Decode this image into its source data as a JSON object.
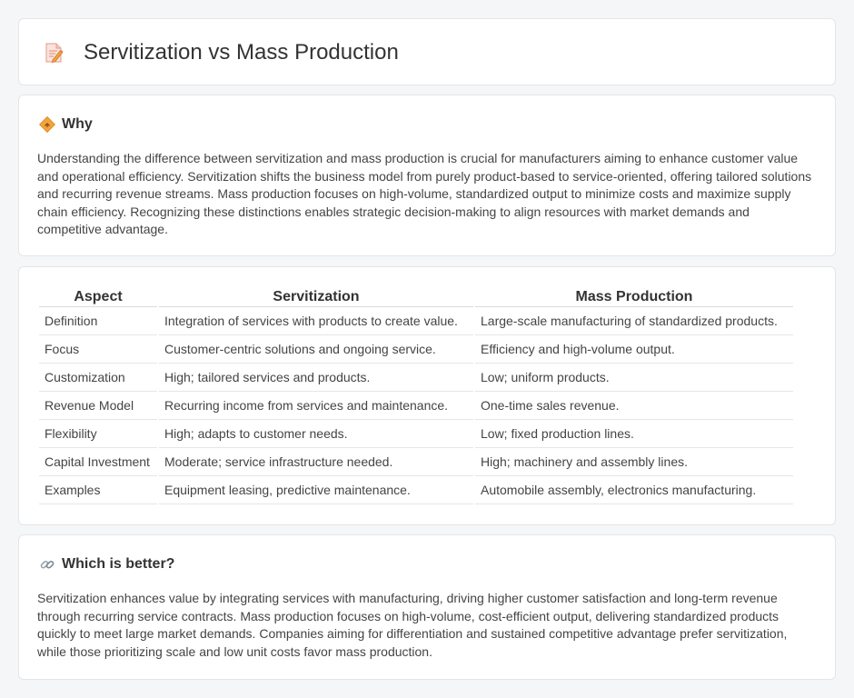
{
  "page": {
    "title": "Servitization vs Mass Production",
    "title_icon": "document-pencil-icon"
  },
  "why": {
    "icon": "diamond-sign-icon",
    "heading": "Why",
    "text": "Understanding the difference between servitization and mass production is crucial for manufacturers aiming to enhance customer value and operational efficiency. Servitization shifts the business model from purely product-based to service-oriented, offering tailored solutions and recurring revenue streams. Mass production focuses on high-volume, standardized output to minimize costs and maximize supply chain efficiency. Recognizing these distinctions enables strategic decision-making to align resources with market demands and competitive advantage."
  },
  "table": {
    "headers": [
      "Aspect",
      "Servitization",
      "Mass Production"
    ],
    "rows": [
      [
        "Definition",
        "Integration of services with products to create value.",
        "Large-scale manufacturing of standardized products."
      ],
      [
        "Focus",
        "Customer-centric solutions and ongoing service.",
        "Efficiency and high-volume output."
      ],
      [
        "Customization",
        "High; tailored services and products.",
        "Low; uniform products."
      ],
      [
        "Revenue Model",
        "Recurring income from services and maintenance.",
        "One-time sales revenue."
      ],
      [
        "Flexibility",
        "High; adapts to customer needs.",
        "Low; fixed production lines."
      ],
      [
        "Capital Investment",
        "Moderate; service infrastructure needed.",
        "High; machinery and assembly lines."
      ],
      [
        "Examples",
        "Equipment leasing, predictive maintenance.",
        "Automobile assembly, electronics manufacturing."
      ]
    ]
  },
  "better": {
    "icon": "link-icon",
    "heading": "Which is better?",
    "text": "Servitization enhances value by integrating services with manufacturing, driving higher customer satisfaction and long-term revenue through recurring service contracts. Mass production focuses on high-volume, cost-efficient output, delivering standardized products quickly to meet large market demands. Companies aiming for differentiation and sustained competitive advantage prefer servitization, while those prioritizing scale and low unit costs favor mass production."
  },
  "colors": {
    "background": "#f5f6f8",
    "card": "#ffffff",
    "accent_orange": "#f2a33a",
    "icon_pink": "#e8776b"
  }
}
